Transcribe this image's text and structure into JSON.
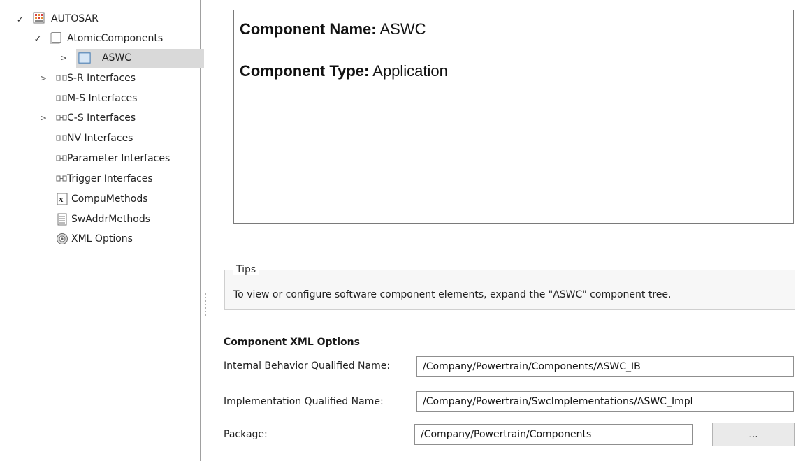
{
  "tree": {
    "root": "AUTOSAR",
    "atomic_components": "AtomicComponents",
    "aswc": "ASWC",
    "sr_interfaces": "S-R Interfaces",
    "ms_interfaces": "M-S Interfaces",
    "cs_interfaces": "C-S Interfaces",
    "nv_interfaces": "NV Interfaces",
    "parameter_interfaces": "Parameter Interfaces",
    "trigger_interfaces": "Trigger Interfaces",
    "compu_methods": "CompuMethods",
    "sw_addr_methods": "SwAddrMethods",
    "xml_options": "XML Options"
  },
  "summary": {
    "name_label": "Component Name:",
    "name_value": "ASWC",
    "type_label": "Component Type:",
    "type_value": "Application"
  },
  "tips": {
    "title": "Tips",
    "text": "To view or configure software component elements, expand the \"ASWC\" component tree."
  },
  "xml_options": {
    "title": "Component XML Options",
    "internal_behavior_label": "Internal Behavior Qualified Name:",
    "internal_behavior_value": "/Company/Powertrain/Components/ASWC_IB",
    "implementation_label": "Implementation Qualified Name:",
    "implementation_value": "/Company/Powertrain/SwcImplementations/ASWC_Impl",
    "package_label": "Package:",
    "package_value": "/Company/Powertrain/Components",
    "browse_label": "..."
  }
}
